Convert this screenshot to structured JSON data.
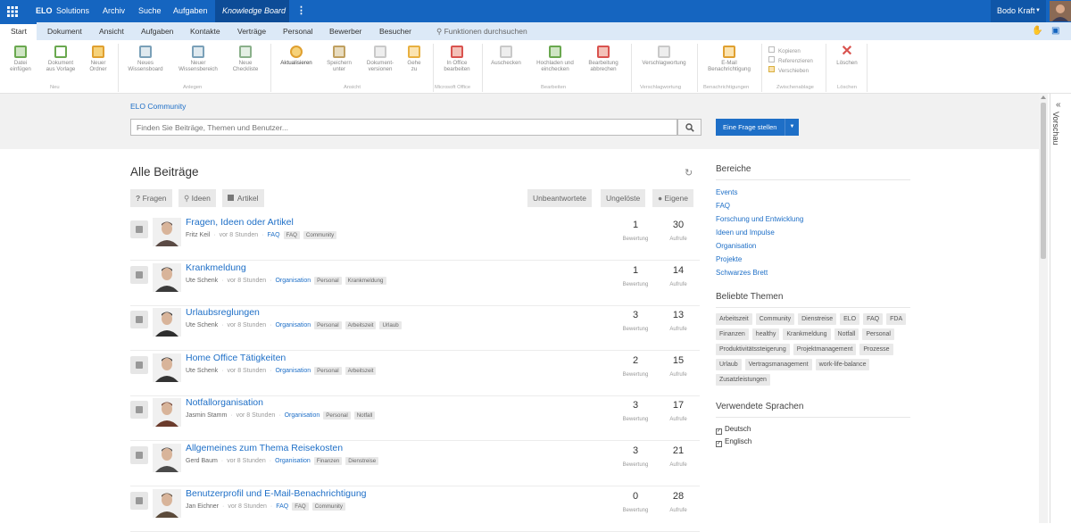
{
  "topbar": {
    "brand_bold": "ELO",
    "brand_rest": "Solutions",
    "nav": [
      "Archiv",
      "Suche",
      "Aufgaben",
      "Knowledge Board"
    ],
    "user": "Bodo Kraft"
  },
  "ribbon_tabs": {
    "items": [
      "Start",
      "Dokument",
      "Ansicht",
      "Aufgaben",
      "Kontakte",
      "Verträge",
      "Personal",
      "Bewerber",
      "Besucher"
    ],
    "search": "Funktionen durchsuchen"
  },
  "ribbon": {
    "buttons": [
      {
        "line1": "Datei",
        "line2": "einfügen",
        "color": "#6aa84f"
      },
      {
        "line1": "Dokument",
        "line2": "aus Vorlage",
        "color": "#6aa84f"
      },
      {
        "line1": "Neuer",
        "line2": "Ordner",
        "color": "#e0a030"
      },
      {
        "line1": "Neues",
        "line2": "Wissensboard",
        "color": "#7aa0b8"
      },
      {
        "line1": "Neuer",
        "line2": "Wissensbereich",
        "color": "#7aa0b8"
      },
      {
        "line1": "Neue",
        "line2": "Checkliste",
        "color": "#8ab08a"
      },
      {
        "line1": "Aktualisieren",
        "line2": "",
        "color": "#e0a030"
      },
      {
        "line1": "Speichern",
        "line2": "unter",
        "color": "#c0a060"
      },
      {
        "line1": "Dokument-",
        "line2": "versionen",
        "color": "#c9c9c9"
      },
      {
        "line1": "Gehe",
        "line2": "zu",
        "color": "#e8b040"
      },
      {
        "line1": "In Office",
        "line2": "bearbeiten",
        "color": "#d9534f"
      },
      {
        "line1": "Auschecken",
        "line2": "",
        "color": "#c9c9c9"
      },
      {
        "line1": "Hochladen und",
        "line2": "einchecken",
        "color": "#6aa84f"
      },
      {
        "line1": "Bearbeitung",
        "line2": "abbrechen",
        "color": "#d9534f"
      },
      {
        "line1": "Verschlagwortung",
        "line2": "",
        "color": "#c9c9c9"
      },
      {
        "line1": "E-Mail",
        "line2": "Benachrichtigung",
        "color": "#e0a030"
      },
      {
        "line1": "Löschen",
        "line2": "",
        "color": "#d9534f"
      }
    ],
    "small_buttons": [
      "Kopieren",
      "Referenzieren",
      "Verschieben"
    ],
    "groups": [
      "Neu",
      "Anlegen",
      "Ansicht",
      "Microsoft Office",
      "Bearbeiten",
      "Verschlagwortung",
      "Benachrichtigungen",
      "Zwischenablage",
      "Löschen"
    ]
  },
  "search": {
    "community": "ELO Community",
    "placeholder": "Finden Sie Beiträge, Themen und Benutzer...",
    "ask_button": "Eine Frage stellen"
  },
  "preview_label": "Vorschau",
  "main": {
    "title": "Alle Beiträge",
    "filters_left": [
      "Fragen",
      "Ideen",
      "Artikel"
    ],
    "filters_right": [
      "Unbeantwortete",
      "Ungelöste",
      "Eigene"
    ],
    "rating_label": "Bewertung",
    "views_label": "Aufrufe",
    "posts": [
      {
        "title": "Fragen, Ideen oder Artikel",
        "author": "Fritz Keil",
        "time": "vor 8 Stunden",
        "category": "FAQ",
        "tags": [
          "FAQ",
          "Community"
        ],
        "rating": "1",
        "views": "30"
      },
      {
        "title": "Krankmeldung",
        "author": "Ute Schenk",
        "time": "vor 8 Stunden",
        "category": "Organisation",
        "tags": [
          "Personal",
          "Krankmeldung"
        ],
        "rating": "1",
        "views": "14"
      },
      {
        "title": "Urlaubsreglungen",
        "author": "Ute Schenk",
        "time": "vor 8 Stunden",
        "category": "Organisation",
        "tags": [
          "Personal",
          "Arbeitszeit",
          "Urlaub"
        ],
        "rating": "3",
        "views": "13"
      },
      {
        "title": "Home Office Tätigkeiten",
        "author": "Ute Schenk",
        "time": "vor 8 Stunden",
        "category": "Organisation",
        "tags": [
          "Personal",
          "Arbeitszeit"
        ],
        "rating": "2",
        "views": "15"
      },
      {
        "title": "Notfallorganisation",
        "author": "Jasmin Stamm",
        "time": "vor 8 Stunden",
        "category": "Organisation",
        "tags": [
          "Personal",
          "Notfall"
        ],
        "rating": "3",
        "views": "17"
      },
      {
        "title": "Allgemeines zum Thema Reisekosten",
        "author": "Gerd Baum",
        "time": "vor 8 Stunden",
        "category": "Organisation",
        "tags": [
          "Finanzen",
          "Dienstreise"
        ],
        "rating": "3",
        "views": "21"
      },
      {
        "title": "Benutzerprofil und E-Mail-Benachrichtigung",
        "author": "Jan Eichner",
        "time": "vor 8 Stunden",
        "category": "FAQ",
        "tags": [
          "FAQ",
          "Community"
        ],
        "rating": "0",
        "views": "28"
      }
    ]
  },
  "sidebar": {
    "areas_title": "Bereiche",
    "areas": [
      "Events",
      "FAQ",
      "Forschung und Entwicklung",
      "Ideen und Impulse",
      "Organisation",
      "Projekte",
      "Schwarzes Brett"
    ],
    "topics_title": "Beliebte Themen",
    "topics": [
      "Arbeitszeit",
      "Community",
      "Dienstreise",
      "ELO",
      "FAQ",
      "FDA",
      "Finanzen",
      "healthy",
      "Krankmeldung",
      "Notfall",
      "Personal",
      "Produktivitätssteigerung",
      "Projektmanagement",
      "Prozesse",
      "Urlaub",
      "Vertragsmanagement",
      "work-life-balance",
      "Zusatzleistungen"
    ],
    "languages_title": "Verwendete Sprachen",
    "languages": [
      "Deutsch",
      "Englisch"
    ]
  }
}
